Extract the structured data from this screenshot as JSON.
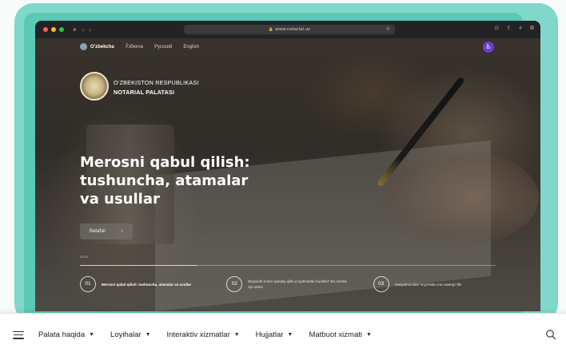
{
  "browser": {
    "url": "www.notarial.uz"
  },
  "site": {
    "languages": [
      {
        "label": "O'zbekcha",
        "active": true
      },
      {
        "label": "Ўзбекча",
        "active": false
      },
      {
        "label": "Русский",
        "active": false
      },
      {
        "label": "English",
        "active": false
      }
    ],
    "logo_line1": "O‘ZBEKISTON RESPUBLIKASI",
    "logo_line2": "NOTARIAL PALATASI",
    "accent": "#6a3fd1"
  },
  "hero": {
    "headline": "Merosni qabul qilish: tushuncha, atamalar va usullar",
    "more_label": "Batafsil",
    "slide_indicator": "01/03",
    "progress_fraction": 0.28,
    "slides": [
      {
        "number": "01",
        "text": "Merosni qabul qilish: tushuncha, atamalar va usullar",
        "active": true
      },
      {
        "number": "02",
        "text": "Beqarorli nomzi qanday qilib yo‘qotmaslik mumkin? Bir nechta ayt rasmi",
        "active": false
      },
      {
        "number": "03",
        "text": "Vasiyatnomalar to‘g‘risida o‘ta notarig‘i fikr",
        "active": false
      }
    ]
  },
  "bottom_nav": {
    "items": [
      {
        "label": "Palata haqida"
      },
      {
        "label": "Loyihalar"
      },
      {
        "label": "Interaktiv xizmatlar"
      },
      {
        "label": "Hujjatlar"
      },
      {
        "label": "Matbuot xizmati"
      }
    ]
  }
}
